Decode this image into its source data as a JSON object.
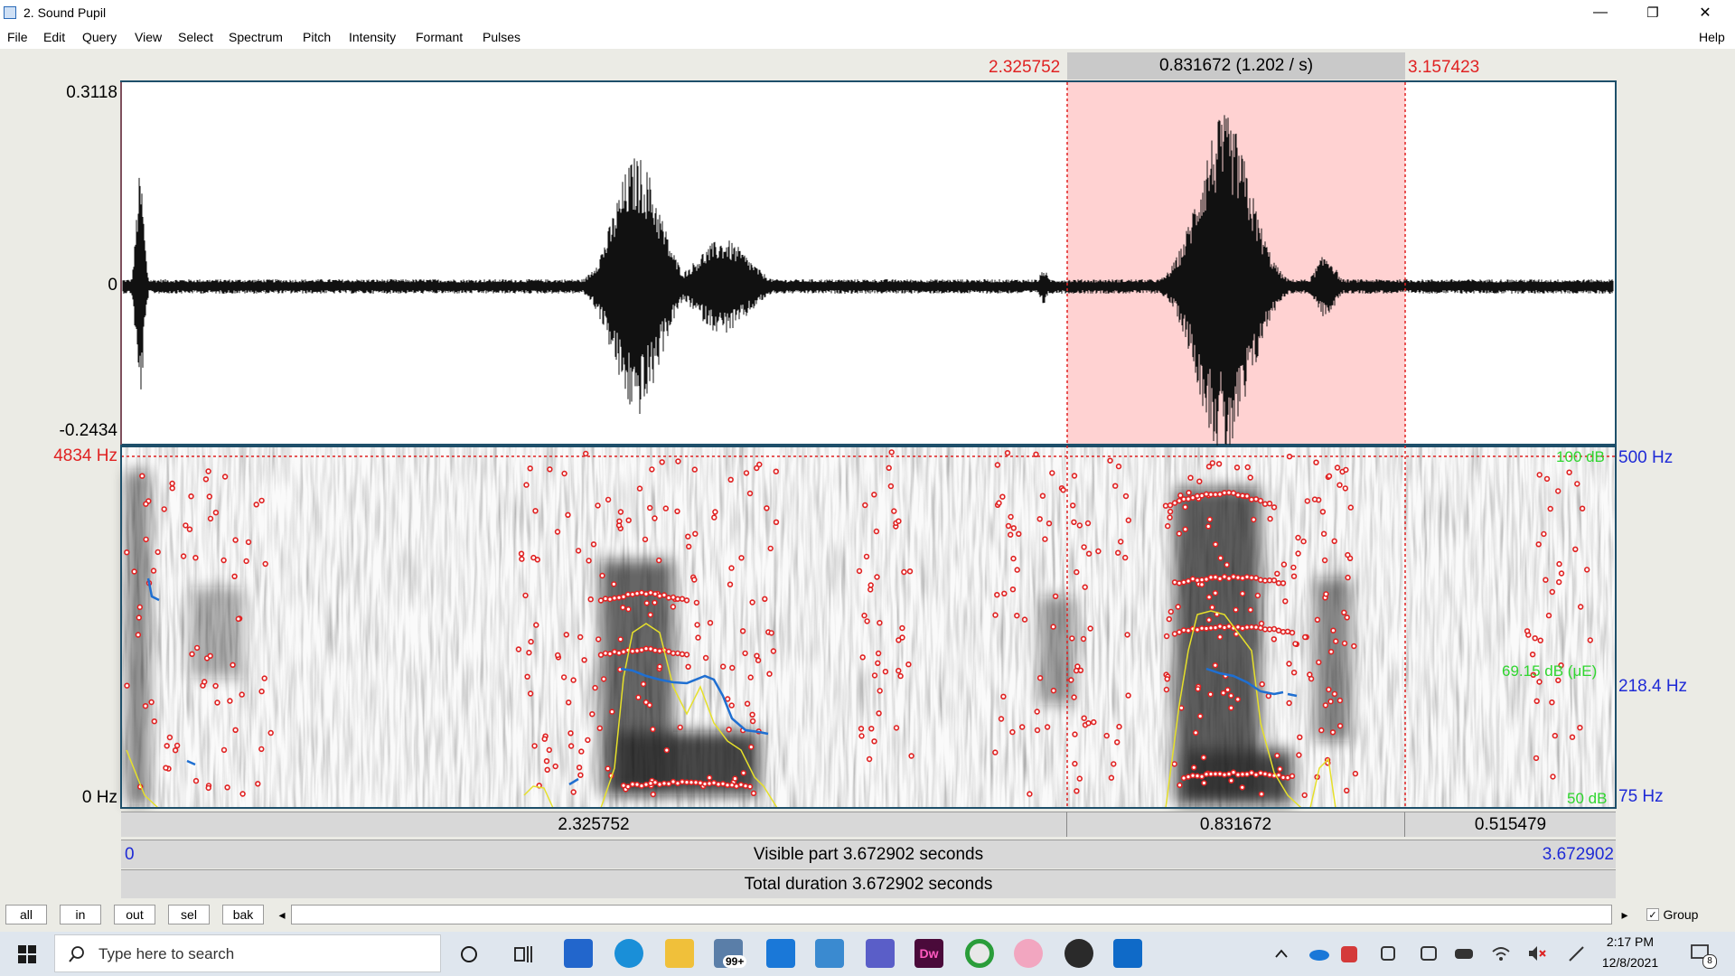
{
  "window": {
    "title": "2. Sound Pupil",
    "minimize": "—",
    "restore": "❐",
    "close": "✕"
  },
  "menu": {
    "items": [
      "File",
      "Edit",
      "Query",
      "View",
      "Select",
      "Spectrum",
      "Pitch",
      "Intensity",
      "Formant",
      "Pulses"
    ],
    "help": "Help"
  },
  "selection": {
    "start": "2.325752",
    "duration": "0.831672 (1.202 / s)",
    "end": "3.157423"
  },
  "waveform": {
    "ymax": "0.3118",
    "yzero": "0",
    "ymin": "-0.2434"
  },
  "spectrogram": {
    "fmax": "4834 Hz",
    "fmin": "0 Hz",
    "pitch_max": "500 Hz",
    "pitch_mid": "218.4 Hz",
    "pitch_min": "75 Hz",
    "intensity_max": "100 dB",
    "intensity_mid": "69.15 dB (μE)",
    "intensity_min": "50 dB"
  },
  "timebars": {
    "before": "2.325752",
    "selected": "0.831672",
    "after": "0.515479",
    "visible_start": "0",
    "visible_label": "Visible part 3.672902 seconds",
    "visible_end": "3.672902",
    "total": "Total duration 3.672902 seconds"
  },
  "controls": {
    "buttons": [
      "all",
      "in",
      "out",
      "sel",
      "bak"
    ],
    "scroll_left": "◂",
    "scroll_right": "▸",
    "group_label": "Group",
    "group_checked": "✓"
  },
  "taskbar": {
    "search_placeholder": "Type here to search",
    "mail_badge": "99+",
    "dw_label": "Dw",
    "time": "2:17 PM",
    "date": "12/8/2021",
    "notification_count": "8"
  }
}
